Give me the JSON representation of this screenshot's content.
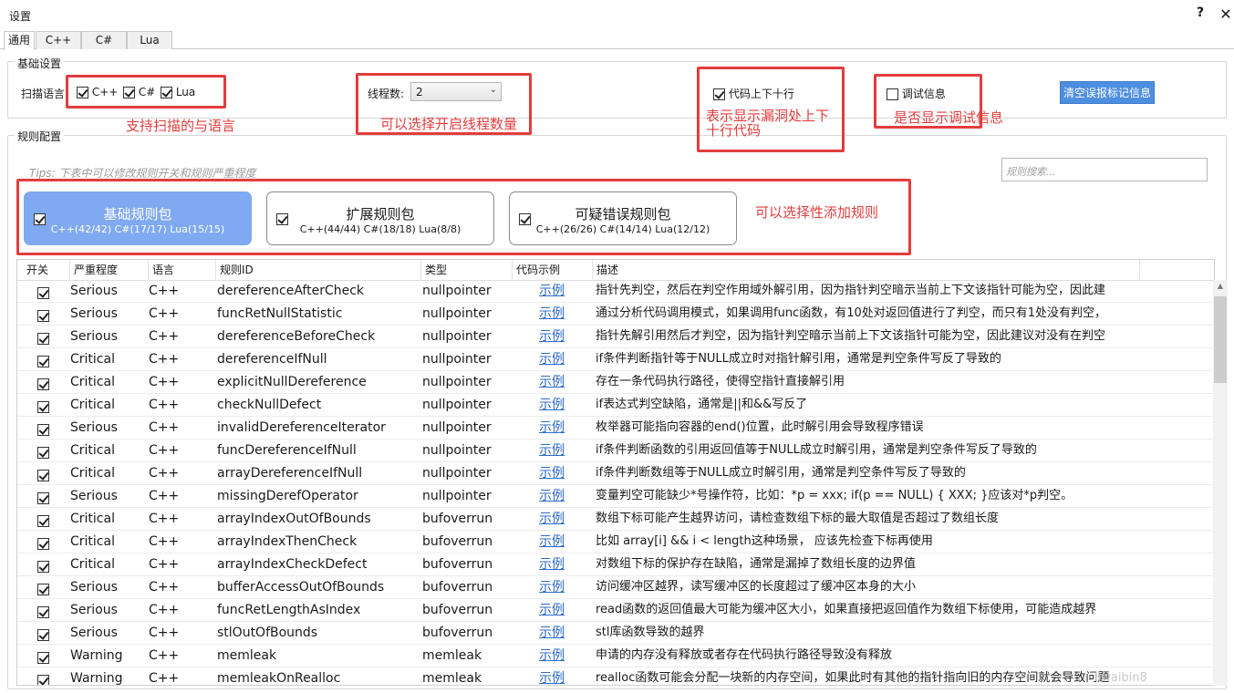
{
  "window": {
    "title": "设置",
    "help": "?",
    "close": "✕"
  },
  "tabs": [
    {
      "label": "通用"
    },
    {
      "label": "C++"
    },
    {
      "label": "C#"
    },
    {
      "label": "Lua"
    }
  ],
  "basic": {
    "group_title": "基础设置",
    "scan_lang_label": "扫描语言:",
    "languages": [
      {
        "label": "C++",
        "checked": true
      },
      {
        "label": "C#",
        "checked": true
      },
      {
        "label": "Lua",
        "checked": true
      }
    ],
    "thread_label": "线程数:",
    "thread_value": "2",
    "context_label": "代码上下十行",
    "context_checked": true,
    "debug_label": "调试信息",
    "debug_checked": false,
    "clear_button": "清空误报标记信息"
  },
  "annotations": {
    "langs": "支持扫描的与语言",
    "threads": "可以选择开启线程数量",
    "context_line1": "表示显示漏洞处上下",
    "context_line2": "十行代码",
    "debug": "是否显示调试信息",
    "rules": "可以选择性添加规则"
  },
  "rules": {
    "group_title": "规则配置",
    "tips": "Tips: 下表中可以修改规则开关和规则严重程度",
    "search_placeholder": "规则搜索...",
    "packs": [
      {
        "title": "基础规则包",
        "stats": "C++(42/42)  C#(17/17)  Lua(15/15)",
        "checked": true,
        "active": true
      },
      {
        "title": "扩展规则包",
        "stats": "C++(44/44)  C#(18/18)  Lua(8/8)",
        "checked": true,
        "active": false
      },
      {
        "title": "可疑错误规则包",
        "stats": "C++(26/26)  C#(14/14)  Lua(12/12)",
        "checked": true,
        "active": false
      }
    ],
    "columns": [
      "开关",
      "严重程度",
      "语言",
      "规则ID",
      "类型",
      "代码示例",
      "描述"
    ],
    "rows": [
      {
        "on": true,
        "severity": "Serious",
        "lang": "C++",
        "id": "dereferenceAfterCheck",
        "type": "nullpointer",
        "example": "示例",
        "desc": "指针先判空，然后在判空作用域外解引用，因为指针判空暗示当前上下文该指针可能为空，因此建"
      },
      {
        "on": true,
        "severity": "Serious",
        "lang": "C++",
        "id": "funcRetNullStatistic",
        "type": "nullpointer",
        "example": "示例",
        "desc": "通过分析代码调用模式，如果调用func函数，有10处对返回值进行了判空，而只有1处没有判空，"
      },
      {
        "on": true,
        "severity": "Serious",
        "lang": "C++",
        "id": "dereferenceBeforeCheck",
        "type": "nullpointer",
        "example": "示例",
        "desc": "指针先解引用然后才判空，因为指针判空暗示当前上下文该指针可能为空，因此建议对没有在判空"
      },
      {
        "on": true,
        "severity": "Critical",
        "lang": "C++",
        "id": "dereferenceIfNull",
        "type": "nullpointer",
        "example": "示例",
        "desc": "if条件判断指针等于NULL成立时对指针解引用，通常是判空条件写反了导致的"
      },
      {
        "on": true,
        "severity": "Critical",
        "lang": "C++",
        "id": "explicitNullDereference",
        "type": "nullpointer",
        "example": "示例",
        "desc": "存在一条代码执行路径，使得空指针直接解引用"
      },
      {
        "on": true,
        "severity": "Critical",
        "lang": "C++",
        "id": "checkNullDefect",
        "type": "nullpointer",
        "example": "示例",
        "desc": "if表达式判空缺陷，通常是||和&&写反了"
      },
      {
        "on": true,
        "severity": "Serious",
        "lang": "C++",
        "id": "invalidDereferenceIterator",
        "type": "nullpointer",
        "example": "示例",
        "desc": "枚举器可能指向容器的end()位置，此时解引用会导致程序错误"
      },
      {
        "on": true,
        "severity": "Critical",
        "lang": "C++",
        "id": "funcDereferenceIfNull",
        "type": "nullpointer",
        "example": "示例",
        "desc": "if条件判断函数的引用返回值等于NULL成立时解引用，通常是判空条件写反了导致的"
      },
      {
        "on": true,
        "severity": "Critical",
        "lang": "C++",
        "id": "arrayDereferenceIfNull",
        "type": "nullpointer",
        "example": "示例",
        "desc": "if条件判断数组等于NULL成立时解引用，通常是判空条件写反了导致的"
      },
      {
        "on": true,
        "severity": "Serious",
        "lang": "C++",
        "id": "missingDerefOperator",
        "type": "nullpointer",
        "example": "示例",
        "desc": "变量判空可能缺少*号操作符，比如：*p = xxx; if(p == NULL) { XXX; }应该对*p判空。"
      },
      {
        "on": true,
        "severity": "Critical",
        "lang": "C++",
        "id": "arrayIndexOutOfBounds",
        "type": "bufoverrun",
        "example": "示例",
        "desc": "数组下标可能产生越界访问，请检查数组下标的最大取值是否超过了数组长度"
      },
      {
        "on": true,
        "severity": "Critical",
        "lang": "C++",
        "id": "arrayIndexThenCheck",
        "type": "bufoverrun",
        "example": "示例",
        "desc": "比如 array[i] && i < length这种场景， 应该先检查下标再使用"
      },
      {
        "on": true,
        "severity": "Critical",
        "lang": "C++",
        "id": "arrayIndexCheckDefect",
        "type": "bufoverrun",
        "example": "示例",
        "desc": "对数组下标的保护存在缺陷，通常是漏掉了数组长度的边界值"
      },
      {
        "on": true,
        "severity": "Serious",
        "lang": "C++",
        "id": "bufferAccessOutOfBounds",
        "type": "bufoverrun",
        "example": "示例",
        "desc": "访问缓冲区越界，读写缓冲区的长度超过了缓冲区本身的大小"
      },
      {
        "on": true,
        "severity": "Serious",
        "lang": "C++",
        "id": "funcRetLengthAsIndex",
        "type": "bufoverrun",
        "example": "示例",
        "desc": "read函数的返回值最大可能为缓冲区大小，如果直接把返回值作为数组下标使用，可能造成越界"
      },
      {
        "on": true,
        "severity": "Serious",
        "lang": "C++",
        "id": "stlOutOfBounds",
        "type": "bufoverrun",
        "example": "示例",
        "desc": "stl库函数导致的越界"
      },
      {
        "on": true,
        "severity": "Warning",
        "lang": "C++",
        "id": "memleak",
        "type": "memleak",
        "example": "示例",
        "desc": "申请的内存没有释放或者存在代码执行路径导致没有释放"
      },
      {
        "on": true,
        "severity": "Warning",
        "lang": "C++",
        "id": "memleakOnRealloc",
        "type": "memleak",
        "example": "示例",
        "desc": "realloc函数可能会分配一块新的内存空间，如果此时有其他的指针指向旧的内存空间就会导致问题"
      }
    ]
  },
  "watermark": "liwaibin8"
}
